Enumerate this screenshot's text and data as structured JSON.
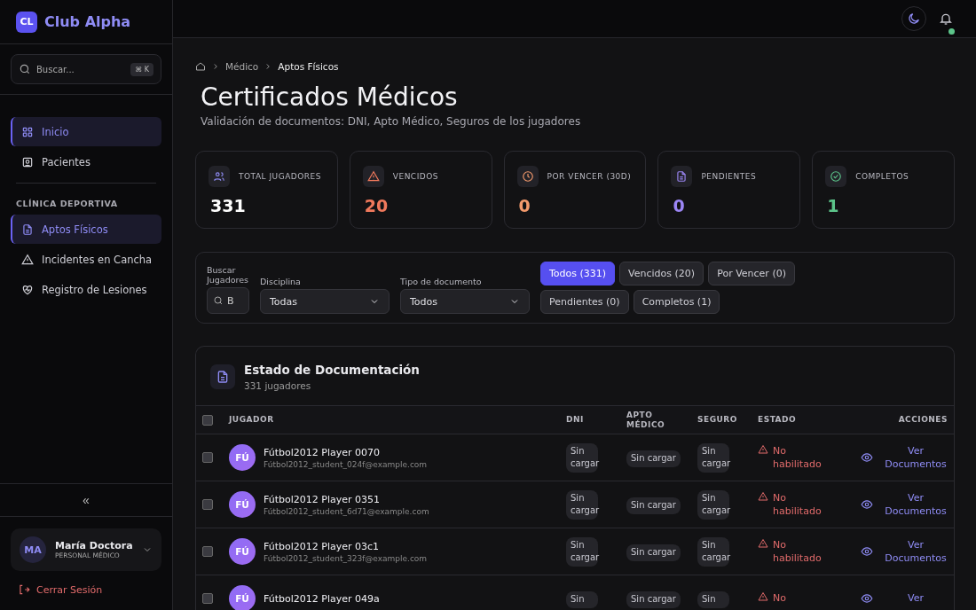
{
  "brand": {
    "logo": "CL",
    "name": "Club Alpha"
  },
  "search": {
    "placeholder": "Buscar...",
    "shortcut": "⌘ K"
  },
  "nav": [
    {
      "label": "Inicio",
      "selected": true
    },
    {
      "label": "Pacientes",
      "selected": false
    }
  ],
  "section_title": "CLÍNICA DEPORTIVA",
  "section_nav": [
    {
      "label": "Aptos Físicos",
      "selected": true
    },
    {
      "label": "Incidentes en Cancha",
      "selected": false
    },
    {
      "label": "Registro de Lesiones",
      "selected": false
    }
  ],
  "collapse": "«",
  "user": {
    "initials": "MA",
    "name": "María Doctora",
    "role": "PERSONAL MÉDICO"
  },
  "logout": "Cerrar Sesión",
  "notifications": {
    "unread": true
  },
  "breadcrumb": [
    "Médico",
    "Aptos Físicos"
  ],
  "title": "Certificados Médicos",
  "subtitle": "Validación de documentos: DNI, Apto Médico, Seguros de los jugadores",
  "stats": [
    {
      "label": "TOTAL JUGADORES",
      "value": "331",
      "color": "#ffffff"
    },
    {
      "label": "VENCIDOS",
      "value": "20",
      "color": "#f0795c"
    },
    {
      "label": "POR VENCER (30D)",
      "value": "0",
      "color": "#f49a6c"
    },
    {
      "label": "PENDIENTES",
      "value": "0",
      "color": "#9c86f5"
    },
    {
      "label": "COMPLETOS",
      "value": "1",
      "color": "#5cc48a"
    }
  ],
  "filters": {
    "search_label": "Buscar Jugadores",
    "search_value": "B",
    "discipline_label": "Disciplina",
    "discipline": "Todas",
    "doctype_label": "Tipo de documento",
    "doctype": "Todos",
    "tabs": [
      {
        "label": "Todos (331)",
        "selected": true
      },
      {
        "label": "Vencidos (20)",
        "selected": false
      },
      {
        "label": "Por Vencer (0)",
        "selected": false
      },
      {
        "label": "Pendientes (0)",
        "selected": false
      },
      {
        "label": "Completos (1)",
        "selected": false
      }
    ]
  },
  "table": {
    "title": "Estado de Documentación",
    "subtitle": "331 jugadores",
    "select_all_checked": false,
    "columns": [
      "JUGADOR",
      "DNI",
      "APTO MÉDICO",
      "SEGURO",
      "ESTADO",
      "ACCIONES"
    ],
    "rows": [
      {
        "checked": false,
        "initials": "FÚ",
        "name": "Fútbol2012 Player 0070",
        "email": "Fútbol2012_student_024f@example.com",
        "dni": "Sin cargar",
        "apto": "Sin cargar",
        "seguro": "Sin cargar",
        "estado": "No habilitado",
        "action": "Ver Documentos"
      },
      {
        "checked": false,
        "initials": "FÚ",
        "name": "Fútbol2012 Player 0351",
        "email": "Fútbol2012_student_6d71@example.com",
        "dni": "Sin cargar",
        "apto": "Sin cargar",
        "seguro": "Sin cargar",
        "estado": "No habilitado",
        "action": "Ver Documentos"
      },
      {
        "checked": false,
        "initials": "FÚ",
        "name": "Fútbol2012 Player 03c1",
        "email": "Fútbol2012_student_323f@example.com",
        "dni": "Sin cargar",
        "apto": "Sin cargar",
        "seguro": "Sin cargar",
        "estado": "No habilitado",
        "action": "Ver Documentos"
      },
      {
        "checked": false,
        "initials": "FÚ",
        "name": "Fútbol2012 Player 049a",
        "dni": "Sin",
        "apto": "Sin cargar",
        "seguro": "Sin",
        "estado": "No",
        "action": "Ver"
      }
    ]
  }
}
